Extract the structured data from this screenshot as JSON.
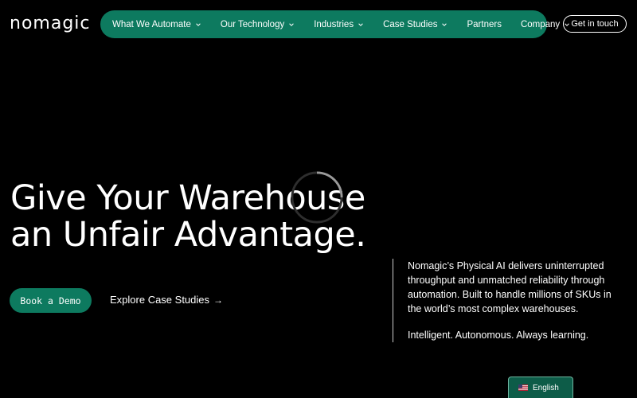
{
  "brand": {
    "logo_text": "nomagic"
  },
  "colors": {
    "background": "#000000",
    "accent": "#0d7a5f",
    "text": "#ffffff"
  },
  "nav": {
    "items": [
      {
        "label": "What We Automate",
        "has_dropdown": true
      },
      {
        "label": "Our Technology",
        "has_dropdown": true
      },
      {
        "label": "Industries",
        "has_dropdown": true
      },
      {
        "label": "Case Studies",
        "has_dropdown": true
      },
      {
        "label": "Partners",
        "has_dropdown": false
      },
      {
        "label": "Company",
        "has_dropdown": true
      }
    ],
    "cta_label": "Get in touch"
  },
  "hero": {
    "headline_line1": "Give Your Warehouse",
    "headline_line2": "an Unfair Advantage.",
    "primary_button": "Book a Demo",
    "secondary_link": "Explore Case Studies",
    "secondary_link_icon": "arrow-right-icon",
    "description": "Nomagic’s Physical AI delivers uninterrupted throughput and unmatched reliability through automation. Built to handle millions of SKUs in the world’s most complex warehouses.",
    "tagline": "Intelligent. Autonomous. Always learning."
  },
  "language_switcher": {
    "label": "English",
    "flag_icon": "us-flag-icon"
  }
}
